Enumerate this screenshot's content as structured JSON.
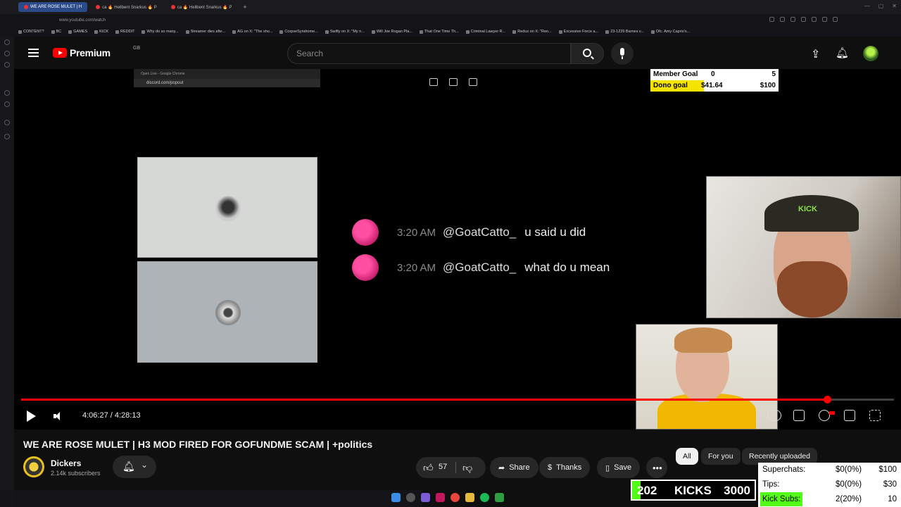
{
  "browser": {
    "tabs": [
      {
        "label": "WE ARE ROSE MULET | H",
        "active": true
      },
      {
        "label": "ca 🔥 Hellbent Snarkus 🔥 P",
        "active": false
      },
      {
        "label": "ca 🔥 Hellbent Snarkus 🔥 P",
        "active": false
      }
    ],
    "url": "www.youtube.com/watch",
    "bookmarks": [
      "CONTENT?",
      "BC",
      "GAMES",
      "KICK",
      "REDDIT",
      "Why do so many...",
      "Streamer dies afte...",
      "AG on X: \"The sho...",
      "CorpseSyndrome...",
      "Swifty on X: \"My n...",
      "Will Joe Rogan Pla...",
      "That One Time Th...",
      "Criminal Lawyer R...",
      "Redux on X: \"Ren...",
      "Excessive Force a...",
      "23-1239 Barnes v...",
      "Ofc. Amy Caprio's..."
    ]
  },
  "header": {
    "brand": "Premium",
    "region": "GB",
    "search_placeholder": "Search"
  },
  "video": {
    "popout": {
      "window_title": "Open Live - Google Chrome",
      "url": "discord.com/popout"
    },
    "goal": {
      "member_label": "Member Goal",
      "member_current": "0",
      "member_target": "5",
      "dono_label": "Dono goal",
      "dono_current": "$41.64",
      "dono_target": "$100",
      "dono_progress": 0.4164
    },
    "messages": [
      {
        "time": "3:20 AM",
        "user": "@GoatCatto_",
        "text": "u said u did"
      },
      {
        "time": "3:20 AM",
        "user": "@GoatCatto_",
        "text": "what do u mean"
      }
    ],
    "cam_cap_text": "KICK",
    "progress": 0.9233,
    "time": "4:06:27 / 4:28:13"
  },
  "info": {
    "title": "WE ARE ROSE MULET | H3 MOD FIRED FOR GOFUNDME SCAM | +politics",
    "channel": "Dickers",
    "subscribers": "2.14k subscribers",
    "likes": "57",
    "share_label": "Share",
    "thanks_label": "Thanks",
    "save_label": "Save"
  },
  "chips": [
    "All",
    "For you",
    "Recently uploaded"
  ],
  "overlay": {
    "kicks_current": "202",
    "kicks_label": "KICKS",
    "kicks_target": "3000",
    "kicks_progress": 0.0673,
    "superchats_label": "Superchats:",
    "superchats_value": "$0(0%)",
    "superchats_goal": "$100",
    "tips_label": "Tips:",
    "tips_value": "$0(0%)",
    "tips_goal": "$30",
    "kicksubs_label": "Kick Subs:",
    "kicksubs_value": "2(20%)",
    "kicksubs_goal": "10"
  }
}
